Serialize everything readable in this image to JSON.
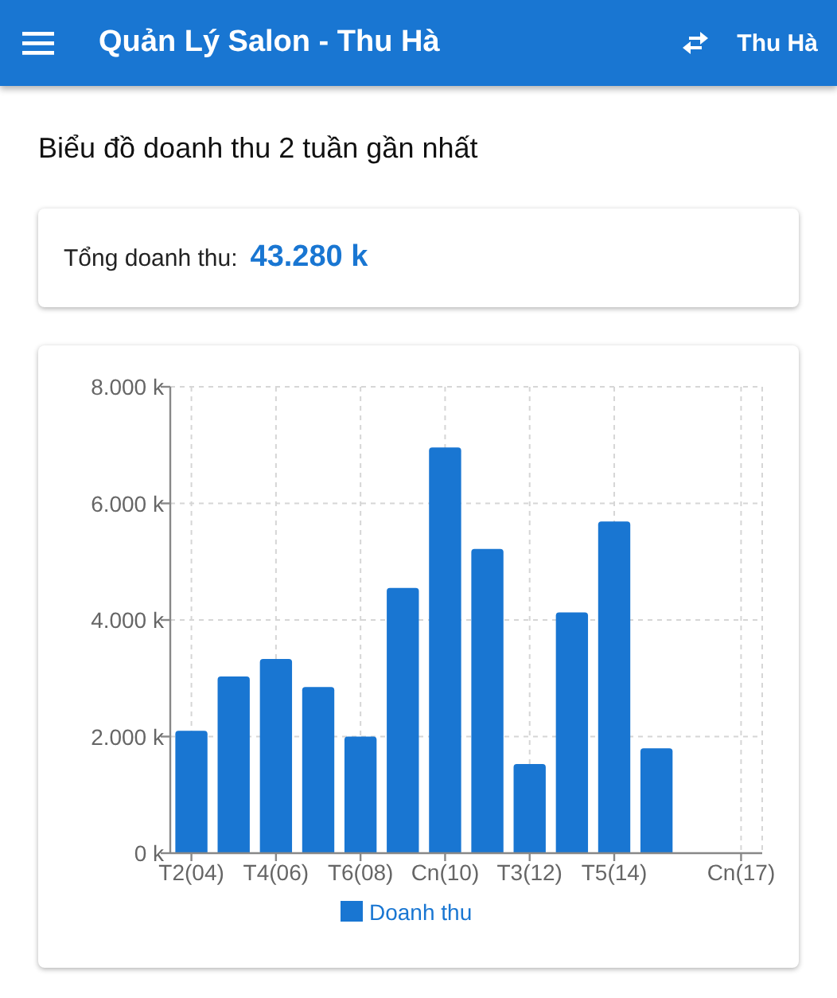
{
  "app_bar": {
    "title": "Quản Lý Salon - Thu Hà",
    "user": "Thu Hà"
  },
  "heading": "Biểu đồ doanh thu 2 tuần gần nhất",
  "summary": {
    "label": "Tổng doanh thu:",
    "value": "43.280 k"
  },
  "chart": {
    "chart_data": {
      "type": "bar",
      "categories": [
        "T2(04)",
        null,
        "T4(06)",
        null,
        "T6(08)",
        null,
        "Cn(10)",
        null,
        "T3(12)",
        null,
        "T5(14)",
        null,
        null,
        "Cn(17)"
      ],
      "series": [
        {
          "name": "Doanh thu",
          "color": "#1976d2",
          "values": [
            2100,
            3030,
            3330,
            2850,
            2000,
            4550,
            6960,
            5220,
            1530,
            4130,
            5690,
            1800,
            null,
            null
          ]
        }
      ],
      "ylim": [
        0,
        8000
      ],
      "grid": true,
      "yticks": [
        {
          "value": 0,
          "label": "0 k"
        },
        {
          "value": 2000,
          "label": "2.000 k"
        },
        {
          "value": 4000,
          "label": "4.000 k"
        },
        {
          "value": 6000,
          "label": "6.000 k"
        },
        {
          "value": 8000,
          "label": "8.000 k"
        }
      ]
    }
  }
}
